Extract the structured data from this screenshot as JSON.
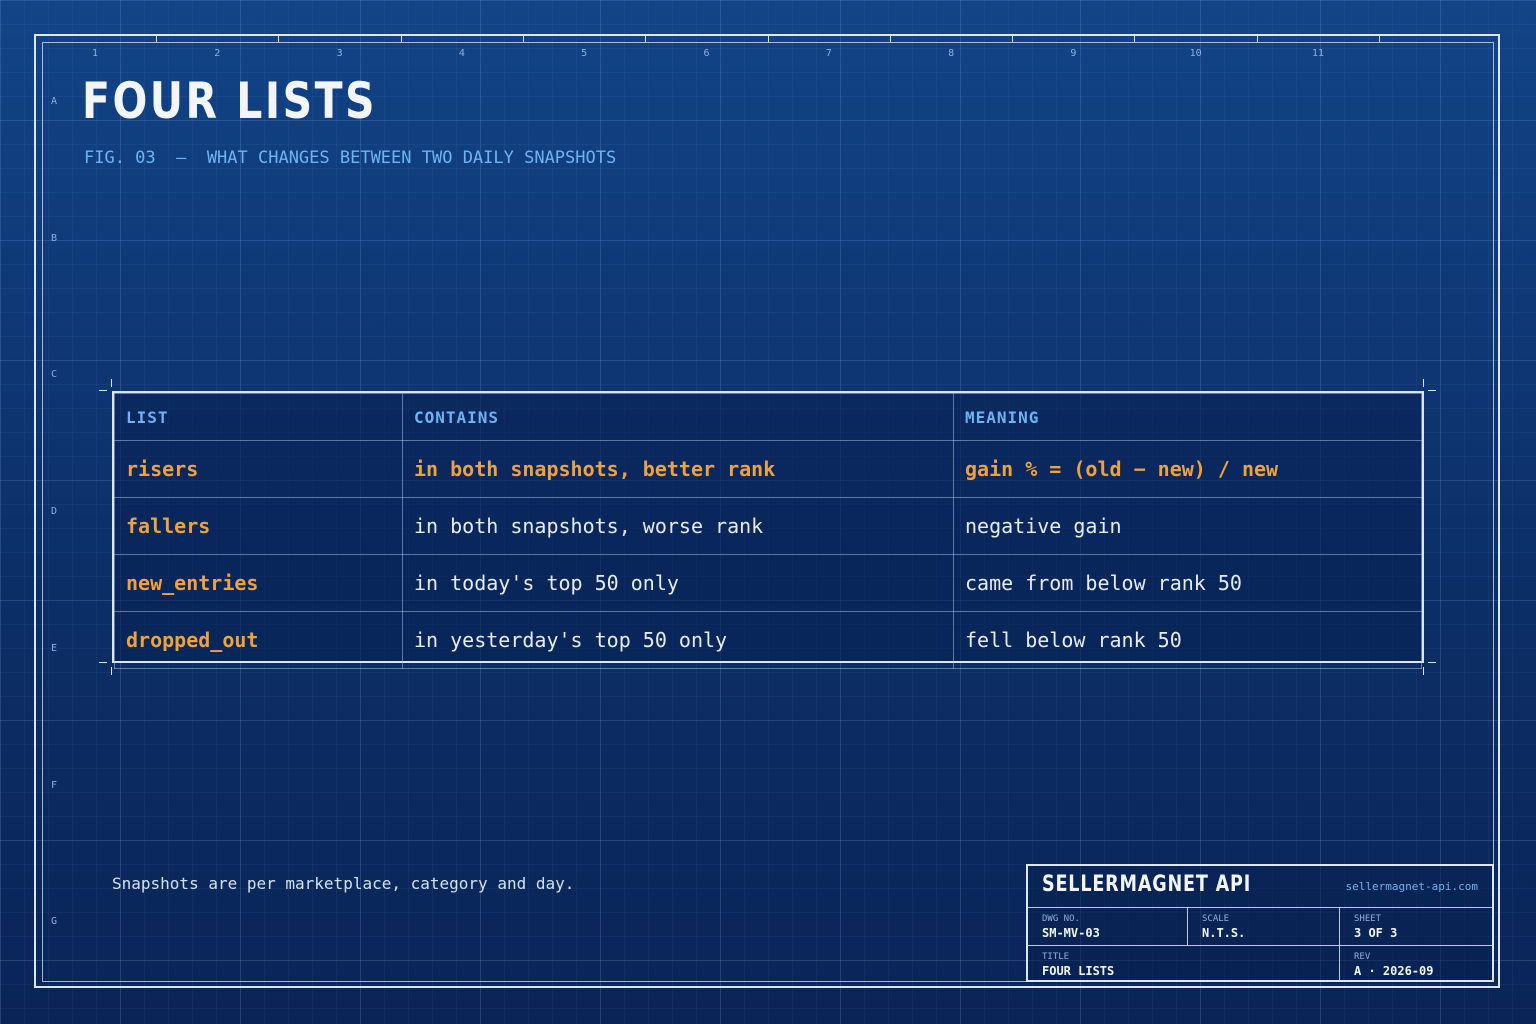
{
  "header": {
    "title": "FOUR LISTS",
    "subtitle": "FIG. 03  —  WHAT CHANGES BETWEEN TWO DAILY SNAPSHOTS"
  },
  "ruler": {
    "columns": [
      "1",
      "2",
      "3",
      "4",
      "5",
      "6",
      "7",
      "8",
      "9",
      "10",
      "11"
    ],
    "rows": [
      "A",
      "B",
      "C",
      "D",
      "E",
      "F",
      "G"
    ]
  },
  "table": {
    "headers": [
      "LIST",
      "CONTAINS",
      "MEANING"
    ],
    "rows": [
      {
        "list": "risers",
        "contains": "in both snapshots, better rank",
        "meaning": "gain % = (old − new) / new",
        "highlighted": true
      },
      {
        "list": "fallers",
        "contains": "in both snapshots, worse rank",
        "meaning": "negative gain",
        "highlighted": false
      },
      {
        "list": "new_entries",
        "contains": "in today's top 50 only",
        "meaning": "came from below rank 50",
        "highlighted": false
      },
      {
        "list": "dropped_out",
        "contains": "in yesterday's top 50 only",
        "meaning": "fell below rank 50",
        "highlighted": false
      }
    ]
  },
  "note": "Snapshots are per marketplace, category and day.",
  "title_block": {
    "brand": "SELLERMAGNET API",
    "url": "sellermagnet-api.com",
    "dwg_no_label": "DWG NO.",
    "dwg_no": "SM-MV-03",
    "scale_label": "SCALE",
    "scale": "N.T.S.",
    "sheet_label": "SHEET",
    "sheet": "3 OF 3",
    "title_label": "TITLE",
    "title": "FOUR LISTS",
    "rev_label": "REV",
    "rev": "A · 2026-09"
  },
  "colors": {
    "accent": "#f0a23a",
    "label_blue": "#6fb4f0",
    "line": "#dbe6f7",
    "background": "#0c2b60"
  }
}
